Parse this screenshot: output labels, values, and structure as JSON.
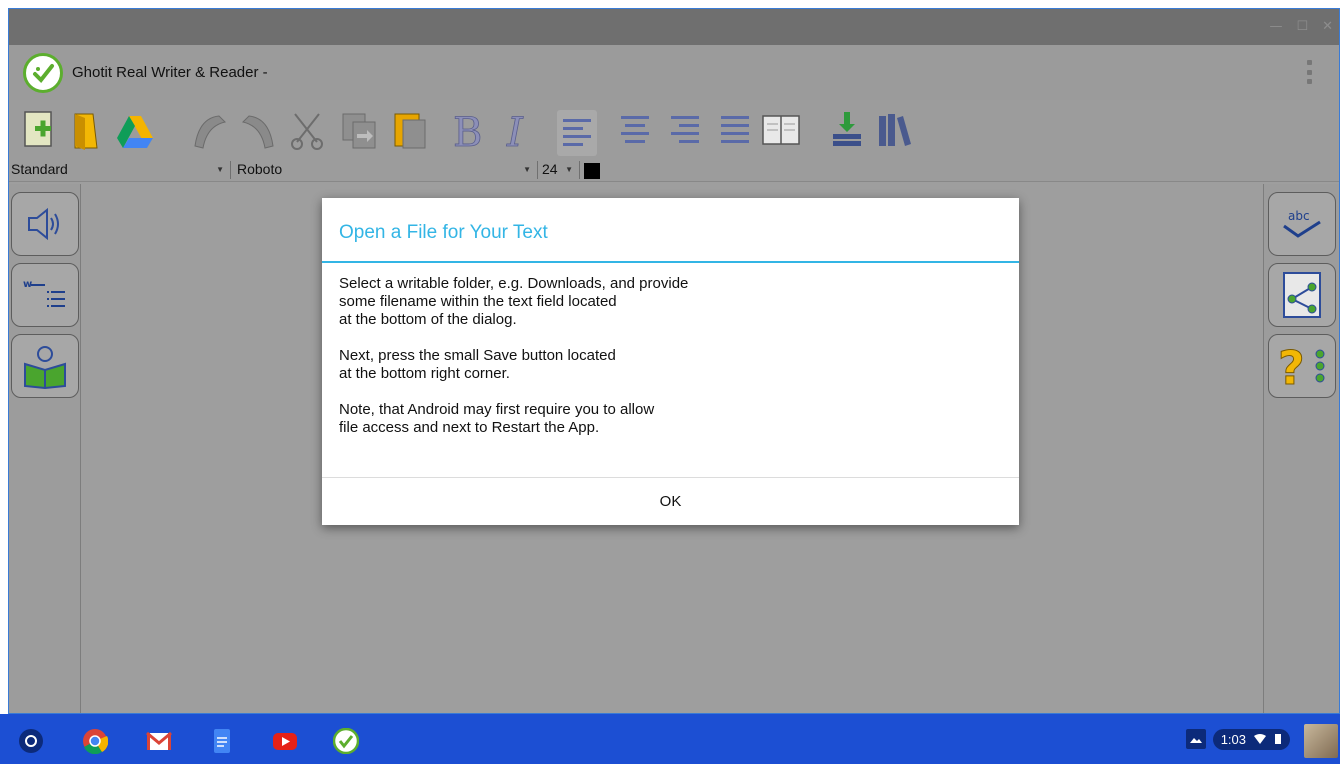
{
  "window": {
    "title": "Ghotit Real Writer & Reader -",
    "controls": [
      "minimize-icon",
      "maximize-icon",
      "close-icon"
    ]
  },
  "toolbar": {
    "icons": [
      "new-file-icon",
      "open-folder-icon",
      "google-drive-icon",
      "undo-icon",
      "redo-icon",
      "cut-icon",
      "copy-icon",
      "paste-icon",
      "bold-icon",
      "italic-icon",
      "align-left-icon",
      "align-center-icon",
      "align-right-icon",
      "justify-icon",
      "book-icon",
      "download-icon",
      "library-icon"
    ]
  },
  "format": {
    "style": "Standard",
    "font": "Roboto",
    "size": "24",
    "color": "#000000"
  },
  "left_panel": [
    "speaker-icon",
    "word-list-icon",
    "reader-icon"
  ],
  "right_panel": [
    "spell-check-icon",
    "share-document-icon",
    "help-icon"
  ],
  "dialog": {
    "title": "Open a File for Your Text",
    "paragraphs": [
      [
        "Select a writable folder, e.g. Downloads, and provide",
        "some filename within the text field located",
        "at the bottom of the dialog."
      ],
      [
        "Next, press the small Save button located",
        "at the bottom right corner."
      ],
      [
        "Note, that Android may first require you to allow",
        "file access and next to Restart the App."
      ]
    ],
    "ok_label": "OK"
  },
  "shelf": {
    "apps": [
      "launcher-icon",
      "chrome-icon",
      "gmail-icon",
      "docs-icon",
      "youtube-icon",
      "ghotit-icon"
    ],
    "time": "1:03"
  },
  "colors": {
    "accent": "#33b5e5",
    "shelf": "#1c4fd3",
    "app_green": "#5cae2e"
  }
}
